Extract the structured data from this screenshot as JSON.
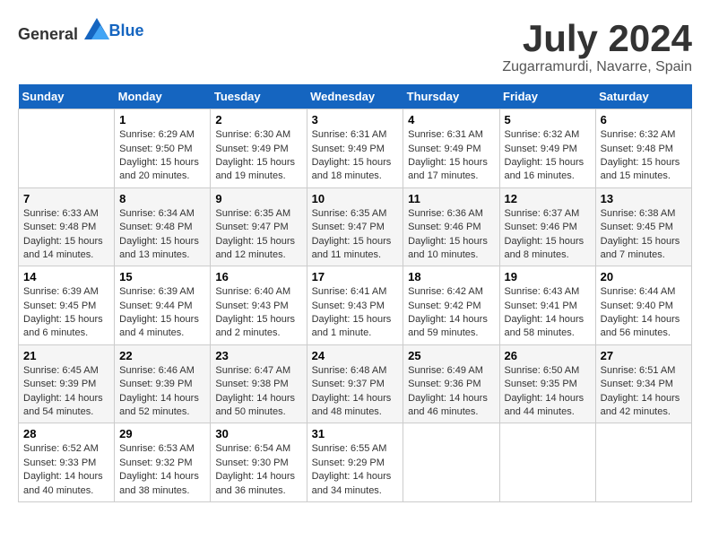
{
  "logo": {
    "general": "General",
    "blue": "Blue"
  },
  "title": "July 2024",
  "subtitle": "Zugarramurdi, Navarre, Spain",
  "days_of_week": [
    "Sunday",
    "Monday",
    "Tuesday",
    "Wednesday",
    "Thursday",
    "Friday",
    "Saturday"
  ],
  "weeks": [
    [
      {
        "day": "",
        "info": ""
      },
      {
        "day": "1",
        "info": "Sunrise: 6:29 AM\nSunset: 9:50 PM\nDaylight: 15 hours and 20 minutes."
      },
      {
        "day": "2",
        "info": "Sunrise: 6:30 AM\nSunset: 9:49 PM\nDaylight: 15 hours and 19 minutes."
      },
      {
        "day": "3",
        "info": "Sunrise: 6:31 AM\nSunset: 9:49 PM\nDaylight: 15 hours and 18 minutes."
      },
      {
        "day": "4",
        "info": "Sunrise: 6:31 AM\nSunset: 9:49 PM\nDaylight: 15 hours and 17 minutes."
      },
      {
        "day": "5",
        "info": "Sunrise: 6:32 AM\nSunset: 9:49 PM\nDaylight: 15 hours and 16 minutes."
      },
      {
        "day": "6",
        "info": "Sunrise: 6:32 AM\nSunset: 9:48 PM\nDaylight: 15 hours and 15 minutes."
      }
    ],
    [
      {
        "day": "7",
        "info": "Sunrise: 6:33 AM\nSunset: 9:48 PM\nDaylight: 15 hours and 14 minutes."
      },
      {
        "day": "8",
        "info": "Sunrise: 6:34 AM\nSunset: 9:48 PM\nDaylight: 15 hours and 13 minutes."
      },
      {
        "day": "9",
        "info": "Sunrise: 6:35 AM\nSunset: 9:47 PM\nDaylight: 15 hours and 12 minutes."
      },
      {
        "day": "10",
        "info": "Sunrise: 6:35 AM\nSunset: 9:47 PM\nDaylight: 15 hours and 11 minutes."
      },
      {
        "day": "11",
        "info": "Sunrise: 6:36 AM\nSunset: 9:46 PM\nDaylight: 15 hours and 10 minutes."
      },
      {
        "day": "12",
        "info": "Sunrise: 6:37 AM\nSunset: 9:46 PM\nDaylight: 15 hours and 8 minutes."
      },
      {
        "day": "13",
        "info": "Sunrise: 6:38 AM\nSunset: 9:45 PM\nDaylight: 15 hours and 7 minutes."
      }
    ],
    [
      {
        "day": "14",
        "info": "Sunrise: 6:39 AM\nSunset: 9:45 PM\nDaylight: 15 hours and 6 minutes."
      },
      {
        "day": "15",
        "info": "Sunrise: 6:39 AM\nSunset: 9:44 PM\nDaylight: 15 hours and 4 minutes."
      },
      {
        "day": "16",
        "info": "Sunrise: 6:40 AM\nSunset: 9:43 PM\nDaylight: 15 hours and 2 minutes."
      },
      {
        "day": "17",
        "info": "Sunrise: 6:41 AM\nSunset: 9:43 PM\nDaylight: 15 hours and 1 minute."
      },
      {
        "day": "18",
        "info": "Sunrise: 6:42 AM\nSunset: 9:42 PM\nDaylight: 14 hours and 59 minutes."
      },
      {
        "day": "19",
        "info": "Sunrise: 6:43 AM\nSunset: 9:41 PM\nDaylight: 14 hours and 58 minutes."
      },
      {
        "day": "20",
        "info": "Sunrise: 6:44 AM\nSunset: 9:40 PM\nDaylight: 14 hours and 56 minutes."
      }
    ],
    [
      {
        "day": "21",
        "info": "Sunrise: 6:45 AM\nSunset: 9:39 PM\nDaylight: 14 hours and 54 minutes."
      },
      {
        "day": "22",
        "info": "Sunrise: 6:46 AM\nSunset: 9:39 PM\nDaylight: 14 hours and 52 minutes."
      },
      {
        "day": "23",
        "info": "Sunrise: 6:47 AM\nSunset: 9:38 PM\nDaylight: 14 hours and 50 minutes."
      },
      {
        "day": "24",
        "info": "Sunrise: 6:48 AM\nSunset: 9:37 PM\nDaylight: 14 hours and 48 minutes."
      },
      {
        "day": "25",
        "info": "Sunrise: 6:49 AM\nSunset: 9:36 PM\nDaylight: 14 hours and 46 minutes."
      },
      {
        "day": "26",
        "info": "Sunrise: 6:50 AM\nSunset: 9:35 PM\nDaylight: 14 hours and 44 minutes."
      },
      {
        "day": "27",
        "info": "Sunrise: 6:51 AM\nSunset: 9:34 PM\nDaylight: 14 hours and 42 minutes."
      }
    ],
    [
      {
        "day": "28",
        "info": "Sunrise: 6:52 AM\nSunset: 9:33 PM\nDaylight: 14 hours and 40 minutes."
      },
      {
        "day": "29",
        "info": "Sunrise: 6:53 AM\nSunset: 9:32 PM\nDaylight: 14 hours and 38 minutes."
      },
      {
        "day": "30",
        "info": "Sunrise: 6:54 AM\nSunset: 9:30 PM\nDaylight: 14 hours and 36 minutes."
      },
      {
        "day": "31",
        "info": "Sunrise: 6:55 AM\nSunset: 9:29 PM\nDaylight: 14 hours and 34 minutes."
      },
      {
        "day": "",
        "info": ""
      },
      {
        "day": "",
        "info": ""
      },
      {
        "day": "",
        "info": ""
      }
    ]
  ]
}
